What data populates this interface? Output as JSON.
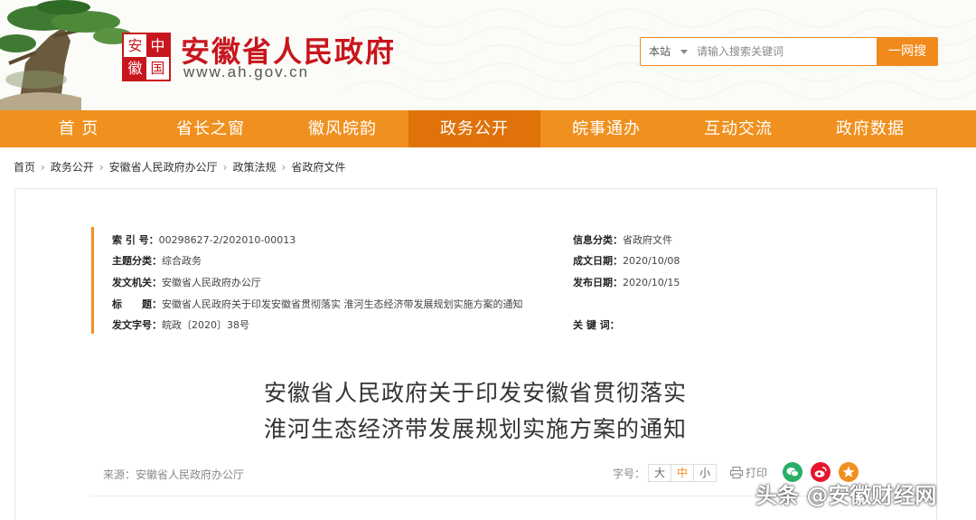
{
  "header": {
    "seal_chars": [
      "安",
      "中",
      "徽",
      "国"
    ],
    "site_title": "安徽省人民政府",
    "site_url": "www.ah.gov.cn"
  },
  "search": {
    "scope": "本站",
    "placeholder": "请输入搜索关键词",
    "button_label": "一网搜"
  },
  "nav": {
    "items": [
      {
        "label": "首 页"
      },
      {
        "label": "省长之窗"
      },
      {
        "label": "徽风皖韵"
      },
      {
        "label": "政务公开"
      },
      {
        "label": "皖事通办"
      },
      {
        "label": "互动交流"
      },
      {
        "label": "政府数据"
      }
    ],
    "active_index": 3
  },
  "breadcrumb": [
    "首页",
    "政务公开",
    "安徽省人民政府办公厅",
    "政策法规",
    "省政府文件"
  ],
  "meta": {
    "index_label": "索 引 号：",
    "index_value": "00298627-2/202010-00013",
    "topic_label": "主题分类：",
    "topic_value": "综合政务",
    "issuer_label": "发文机关：",
    "issuer_value": "安徽省人民政府办公厅",
    "title_label": "标　　题：",
    "title_value": "安徽省人民政府关于印发安徽省贯彻落实 淮河生态经济带发展规划实施方案的通知",
    "docno_label": "发文字号：",
    "docno_value": "皖政〔2020〕38号",
    "info_cat_label": "信息分类：",
    "info_cat_value": "省政府文件",
    "created_label": "成文日期：",
    "created_value": "2020/10/08",
    "published_label": "发布日期：",
    "published_value": "2020/10/15",
    "keywords_label": "关 键 词："
  },
  "document": {
    "title_line1": "安徽省人民政府关于印发安徽省贯彻落实",
    "title_line2": "淮河生态经济带发展规划实施方案的通知",
    "source": "来源：安徽省人民政府办公厅"
  },
  "toolbar": {
    "font_size_label": "字号：",
    "sizes": [
      "大",
      "中",
      "小"
    ],
    "active_size": "中",
    "print_label": "打印",
    "share_icons": [
      "wechat-icon",
      "weibo-icon",
      "star-icon"
    ]
  },
  "watermark": "头条 @安徽财经网",
  "colors": {
    "brand_red": "#c8161d",
    "nav_orange": "#f0901e",
    "nav_active": "#e0720a"
  }
}
